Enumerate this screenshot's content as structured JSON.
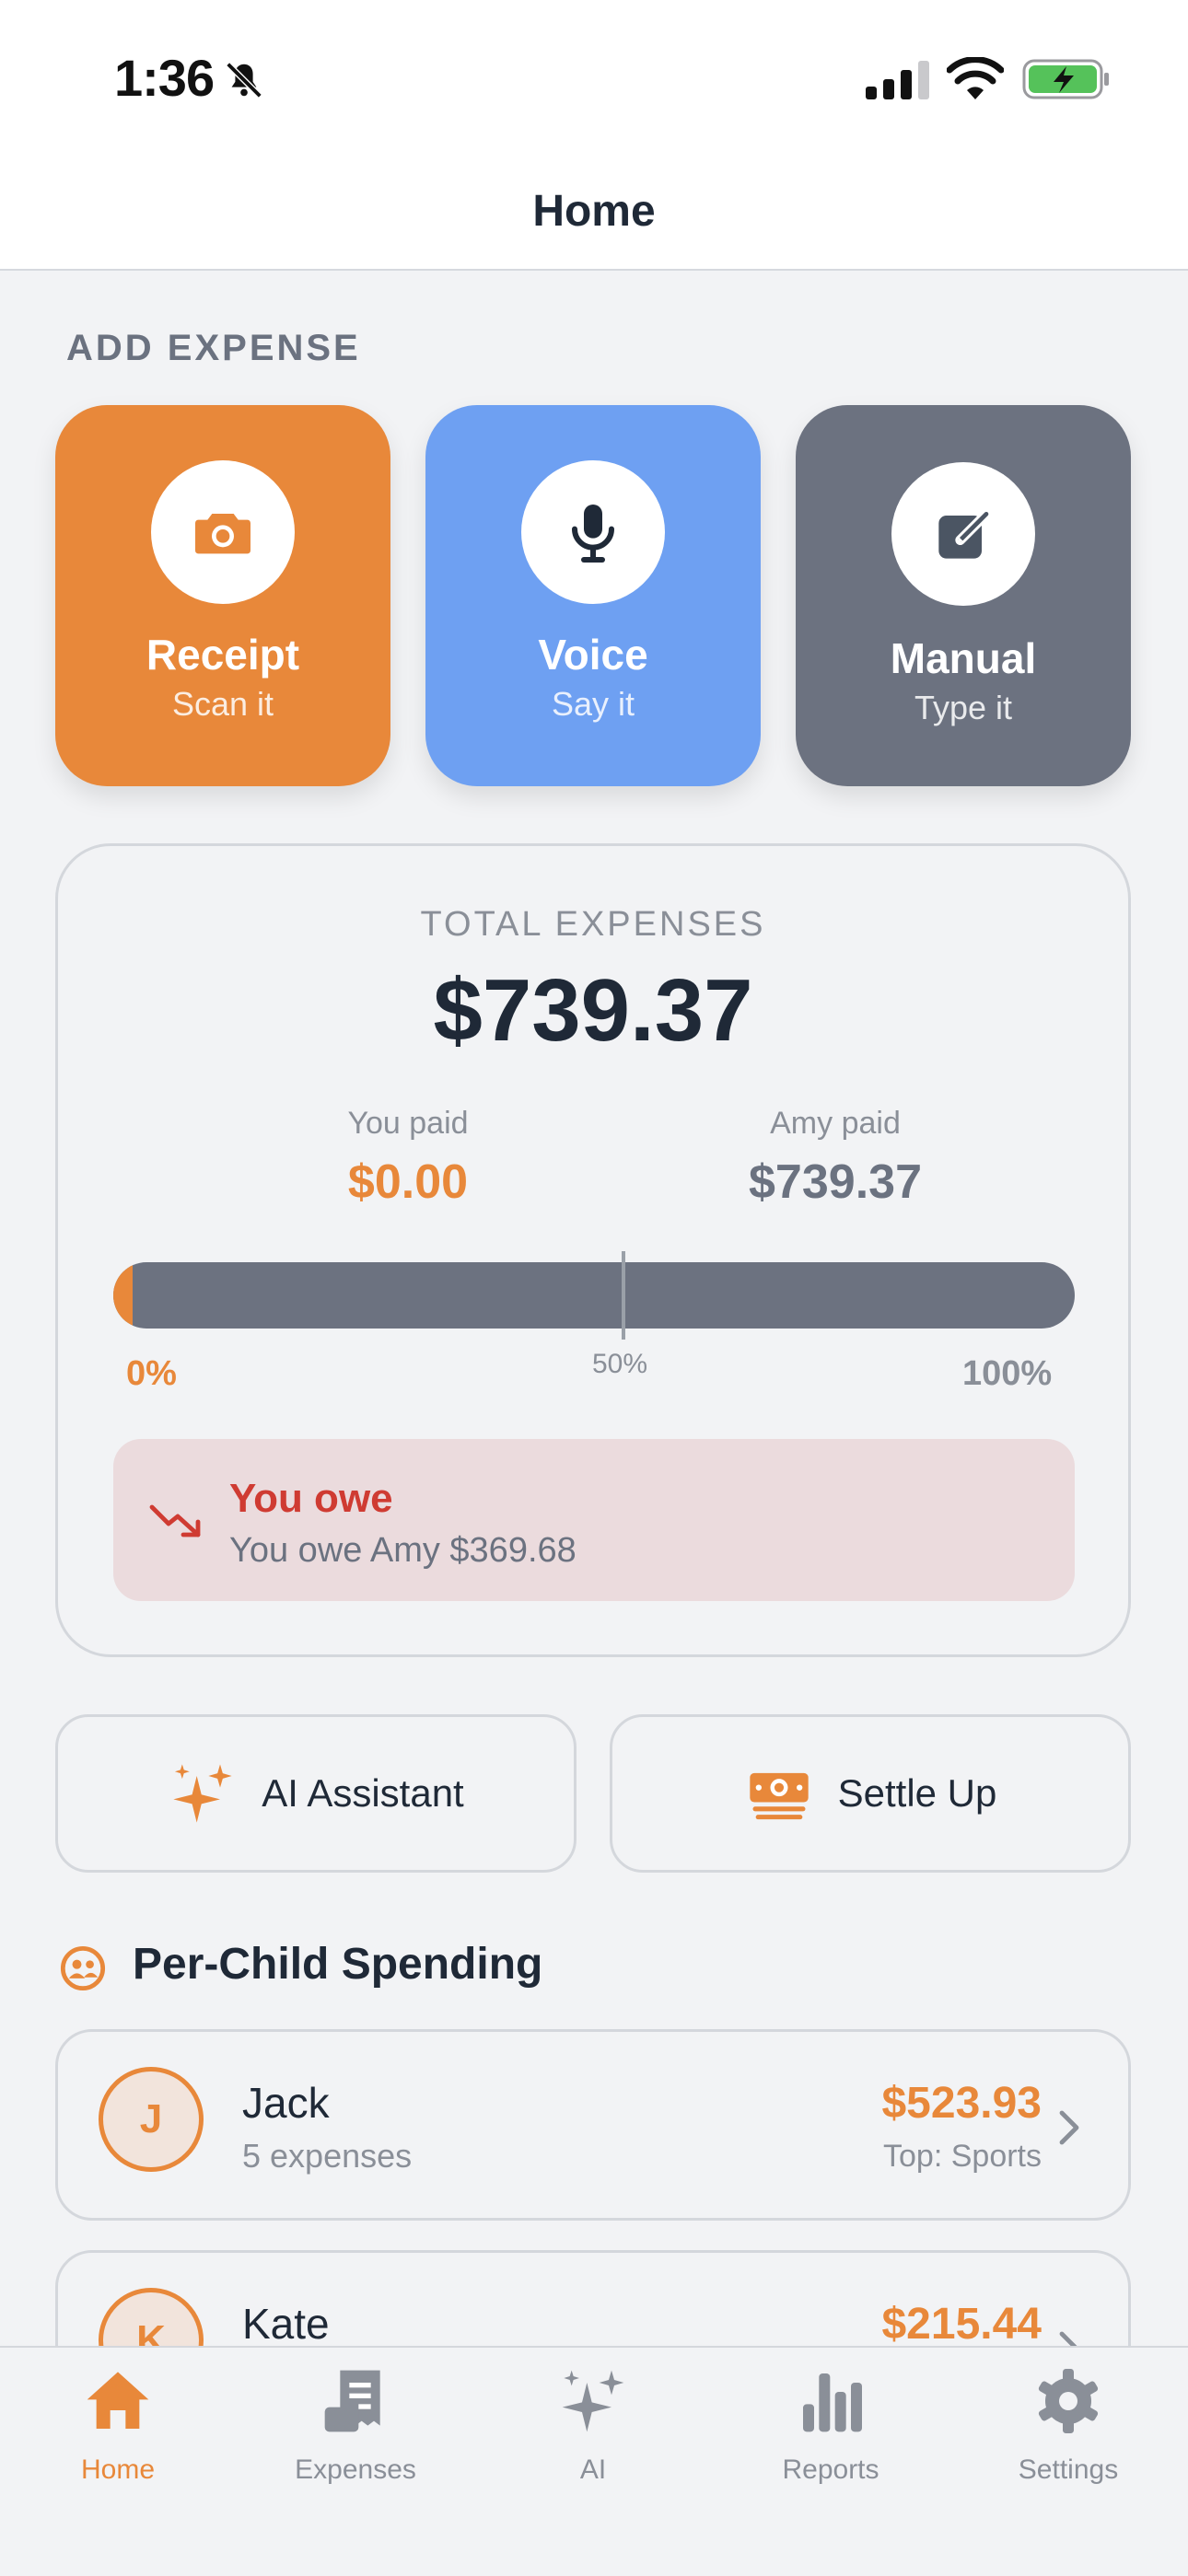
{
  "status_bar": {
    "time": "1:36"
  },
  "nav": {
    "title": "Home"
  },
  "add_expense": {
    "label": "ADD EXPENSE",
    "tiles": [
      {
        "title": "Receipt",
        "subtitle": "Scan it",
        "icon": "camera-icon",
        "color": "#e8883a"
      },
      {
        "title": "Voice",
        "subtitle": "Say it",
        "icon": "microphone-icon",
        "color": "#6ea0f2"
      },
      {
        "title": "Manual",
        "subtitle": "Type it",
        "icon": "pencil-square-icon",
        "color": "#6c7280"
      }
    ]
  },
  "summary": {
    "total_label": "TOTAL EXPENSES",
    "total_value": "$739.37",
    "you_label": "You paid",
    "you_value": "$0.00",
    "amy_label": "Amy paid",
    "amy_value": "$739.37",
    "you_share_fraction": 0.0,
    "pct_left": "0%",
    "pct_mid": "50%",
    "pct_right": "100%",
    "owe_title": "You owe",
    "owe_text": "You owe Amy $369.68",
    "owe_icon": "trending-down-icon"
  },
  "actions": [
    {
      "label": "AI Assistant",
      "icon": "sparkles-icon"
    },
    {
      "label": "Settle Up",
      "icon": "money-icon"
    }
  ],
  "per_child": {
    "title": "Per-Child Spending",
    "icon": "people-icon",
    "children": [
      {
        "initial": "J",
        "name": "Jack",
        "count": "5 expenses",
        "amount": "$523.93",
        "top": "Top: Sports"
      },
      {
        "initial": "K",
        "name": "Kate",
        "count": "",
        "amount": "$215.44",
        "top": ""
      }
    ]
  },
  "tabs": [
    {
      "label": "Home",
      "icon": "home-icon",
      "active": true
    },
    {
      "label": "Expenses",
      "icon": "receipt-icon",
      "active": false
    },
    {
      "label": "AI",
      "icon": "sparkles-icon",
      "active": false
    },
    {
      "label": "Reports",
      "icon": "bar-chart-icon",
      "active": false
    },
    {
      "label": "Settings",
      "icon": "gear-icon",
      "active": false
    }
  ],
  "colors": {
    "accent": "#e8883a",
    "voice": "#6ea0f2",
    "neutral": "#6c7280",
    "danger": "#cf3b32"
  }
}
